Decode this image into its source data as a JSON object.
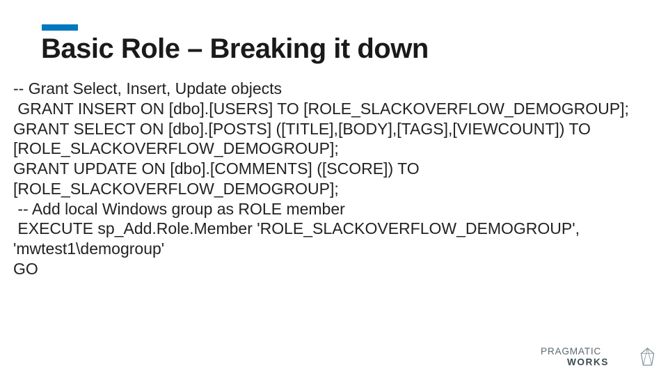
{
  "title": "Basic Role – Breaking it down",
  "lines": [
    "-- Grant Select, Insert, Update objects",
    " GRANT INSERT ON [dbo].[USERS] TO [ROLE_SLACKOVERFLOW_DEMOGROUP];",
    "GRANT SELECT ON [dbo].[POSTS] ([TITLE],[BODY],[TAGS],[VIEWCOUNT]) TO [ROLE_SLACKOVERFLOW_DEMOGROUP];",
    "GRANT UPDATE ON [dbo].[COMMENTS] ([SCORE]) TO [ROLE_SLACKOVERFLOW_DEMOGROUP];",
    " -- Add local Windows group as ROLE member",
    " EXECUTE sp_Add.Role.Member 'ROLE_SLACKOVERFLOW_DEMOGROUP', 'mwtest1\\demogroup'",
    "GO"
  ],
  "logo": {
    "line1": "PRAGMATIC",
    "line2": "WORKS"
  }
}
